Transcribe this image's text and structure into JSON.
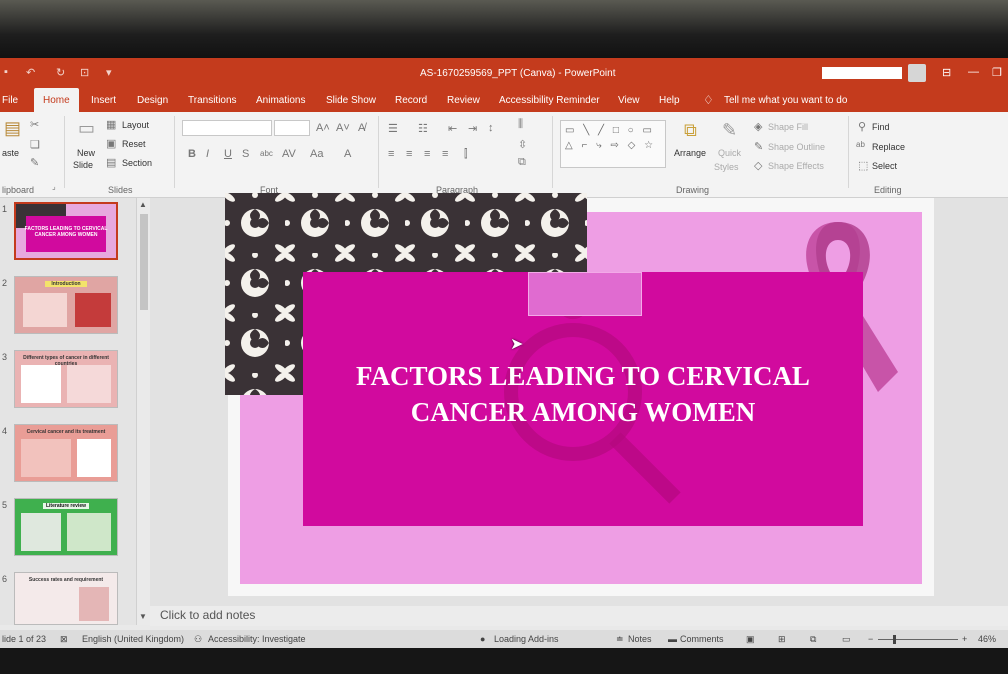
{
  "window": {
    "title": "AS-1670259569_PPT (Canva)  -  PowerPoint",
    "accent": "#c43b1d"
  },
  "tabs": [
    "File",
    "Home",
    "Insert",
    "Design",
    "Transitions",
    "Animations",
    "Slide Show",
    "Record",
    "Review",
    "Accessibility Reminder",
    "View",
    "Help"
  ],
  "tell_me": "Tell me what you want to do",
  "ribbon": {
    "clipboard": {
      "paste": "aste",
      "group": "lipboard"
    },
    "slides": {
      "new_slide_line1": "New",
      "new_slide_line2": "Slide",
      "layout": "Layout",
      "reset": "Reset",
      "section": "Section",
      "group": "Slides"
    },
    "font": {
      "group": "Font"
    },
    "paragraph": {
      "group": "Paragraph"
    },
    "drawing": {
      "arrange": "Arrange",
      "quick_styles_line1": "Quick",
      "quick_styles_line2": "Styles",
      "shape_fill": "Shape Fill",
      "shape_outline": "Shape Outline",
      "shape_effects": "Shape Effects",
      "group": "Drawing"
    },
    "editing": {
      "find": "Find",
      "replace": "Replace",
      "select": "Select",
      "group": "Editing"
    }
  },
  "thumbnails": [
    {
      "num": "1",
      "title": "FACTORS LEADING TO CERVICAL CANCER AMONG WOMEN",
      "bg": "#e7a9de"
    },
    {
      "num": "2",
      "title": "Introduction",
      "bg": "#e0a5a3"
    },
    {
      "num": "3",
      "title": "Different types of cancer in different countries",
      "bg": "#eab3b3"
    },
    {
      "num": "4",
      "title": "Cervical cancer and its treatment",
      "bg": "#e99d96"
    },
    {
      "num": "5",
      "title": "Literature review",
      "bg": "#3fb04e"
    },
    {
      "num": "6",
      "title": "Success rates and requirement",
      "bg": "#f4eaea"
    }
  ],
  "slide": {
    "title_line1": "FACTORS LEADING TO CERVICAL",
    "title_line2": "CANCER AMONG WOMEN",
    "pink": "#ee9ee4",
    "magenta": "#d10a9e",
    "dark": "#3a3236"
  },
  "notes_placeholder": "Click to add notes",
  "status": {
    "slide_count": "lide 1 of 23",
    "language": "English (United Kingdom)",
    "accessibility": "Accessibility: Investigate",
    "addins": "Loading Add-ins",
    "notes": "Notes",
    "comments": "Comments",
    "zoom": "46%"
  }
}
